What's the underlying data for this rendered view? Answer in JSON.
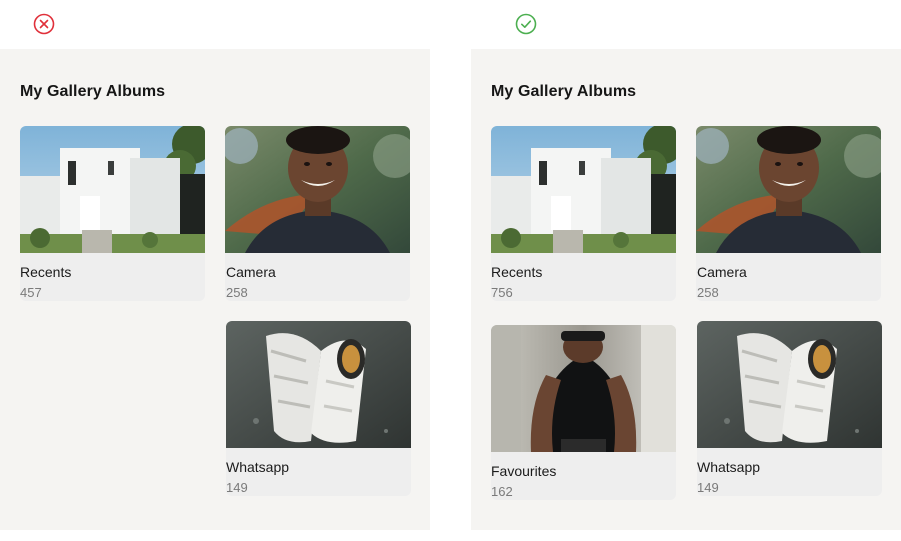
{
  "colors": {
    "bad": "#e0303a",
    "good": "#4caf50",
    "panel_bg": "#f5f4f2",
    "card_bg": "#eeeeee"
  },
  "left": {
    "status_icon": "x-circle-icon",
    "title": "My Gallery Albums",
    "albums": [
      {
        "name": "Recents",
        "count": "457",
        "image": "house-photo"
      },
      {
        "name": "Camera",
        "count": "258",
        "image": "portrait-photo"
      },
      {
        "name": "Whatsapp",
        "count": "149",
        "image": "sneakers-photo"
      }
    ]
  },
  "right": {
    "status_icon": "check-circle-icon",
    "title": "My Gallery Albums",
    "albums": [
      {
        "name": "Recents",
        "count": "756",
        "image": "house-photo"
      },
      {
        "name": "Camera",
        "count": "258",
        "image": "portrait-photo"
      },
      {
        "name": "Favourites",
        "count": "162",
        "image": "athlete-photo"
      },
      {
        "name": "Whatsapp",
        "count": "149",
        "image": "sneakers-photo"
      }
    ]
  }
}
